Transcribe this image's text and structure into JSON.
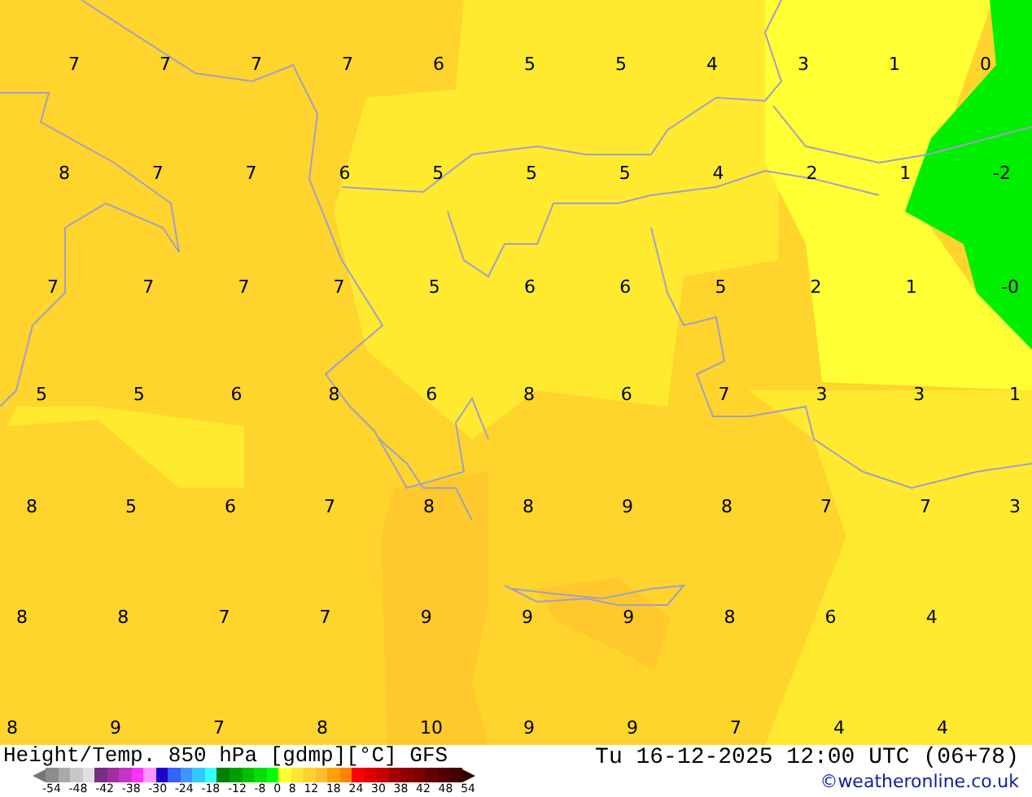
{
  "map": {
    "rows": [
      [
        "7",
        "7",
        "7",
        "7",
        "6",
        "5",
        "5",
        "4",
        "3",
        "1",
        "0"
      ],
      [
        "8",
        "7",
        "7",
        "6",
        "5",
        "5",
        "5",
        "4",
        "2",
        "1",
        "-2"
      ],
      [
        "7",
        "7",
        "7",
        "7",
        "5",
        "6",
        "6",
        "5",
        "2",
        "1",
        "-0"
      ],
      [
        "5",
        "5",
        "6",
        "8",
        "6",
        "8",
        "6",
        "7",
        "3",
        "3",
        "1"
      ],
      [
        "8",
        "5",
        "6",
        "7",
        "8",
        "8",
        "9",
        "8",
        "7",
        "7",
        "3"
      ],
      [
        "8",
        "8",
        "7",
        "7",
        "9",
        "9",
        "9",
        "8",
        "6",
        "4"
      ],
      [
        "8",
        "9",
        "7",
        "8",
        "10",
        "9",
        "9",
        "7",
        "4",
        "4"
      ]
    ]
  },
  "legend": {
    "title": "Height/Temp. 850 hPa [gdmp][°C] GFS",
    "swatches": [
      {
        "color": "#8c8c8c"
      },
      {
        "color": "#aaaaaa"
      },
      {
        "color": "#c8c8c8"
      },
      {
        "color": "#e0e0e0"
      },
      {
        "color": "#7a2e82"
      },
      {
        "color": "#a030a0"
      },
      {
        "color": "#c832c8"
      },
      {
        "color": "#ff32ff"
      },
      {
        "color": "#ff96ff"
      },
      {
        "color": "#2000c8"
      },
      {
        "color": "#3264ff"
      },
      {
        "color": "#4096ff"
      },
      {
        "color": "#32c8ff"
      },
      {
        "color": "#32ffff"
      },
      {
        "color": "#008000"
      },
      {
        "color": "#00a000"
      },
      {
        "color": "#00c000"
      },
      {
        "color": "#00e000"
      },
      {
        "color": "#00ff00"
      },
      {
        "color": "#ffff32"
      },
      {
        "color": "#ffe632"
      },
      {
        "color": "#ffd232"
      },
      {
        "color": "#ffbe32"
      },
      {
        "color": "#ffa000"
      },
      {
        "color": "#ff8200"
      },
      {
        "color": "#ff0000"
      },
      {
        "color": "#e00000"
      },
      {
        "color": "#c80000"
      },
      {
        "color": "#a00000"
      },
      {
        "color": "#900000"
      },
      {
        "color": "#800000"
      },
      {
        "color": "#640000"
      },
      {
        "color": "#500000"
      },
      {
        "color": "#400000"
      }
    ],
    "ticks": [
      "-54",
      "-48",
      "-42",
      "-38",
      "-30",
      "-24",
      "-18",
      "-12",
      "-8",
      "0",
      "8",
      "12",
      "18",
      "24",
      "30",
      "38",
      "42",
      "48",
      "54"
    ]
  },
  "valid_time": "Tu 16-12-2025 12:00 UTC (06+78)",
  "credit": "©weatheronline.co.uk"
}
